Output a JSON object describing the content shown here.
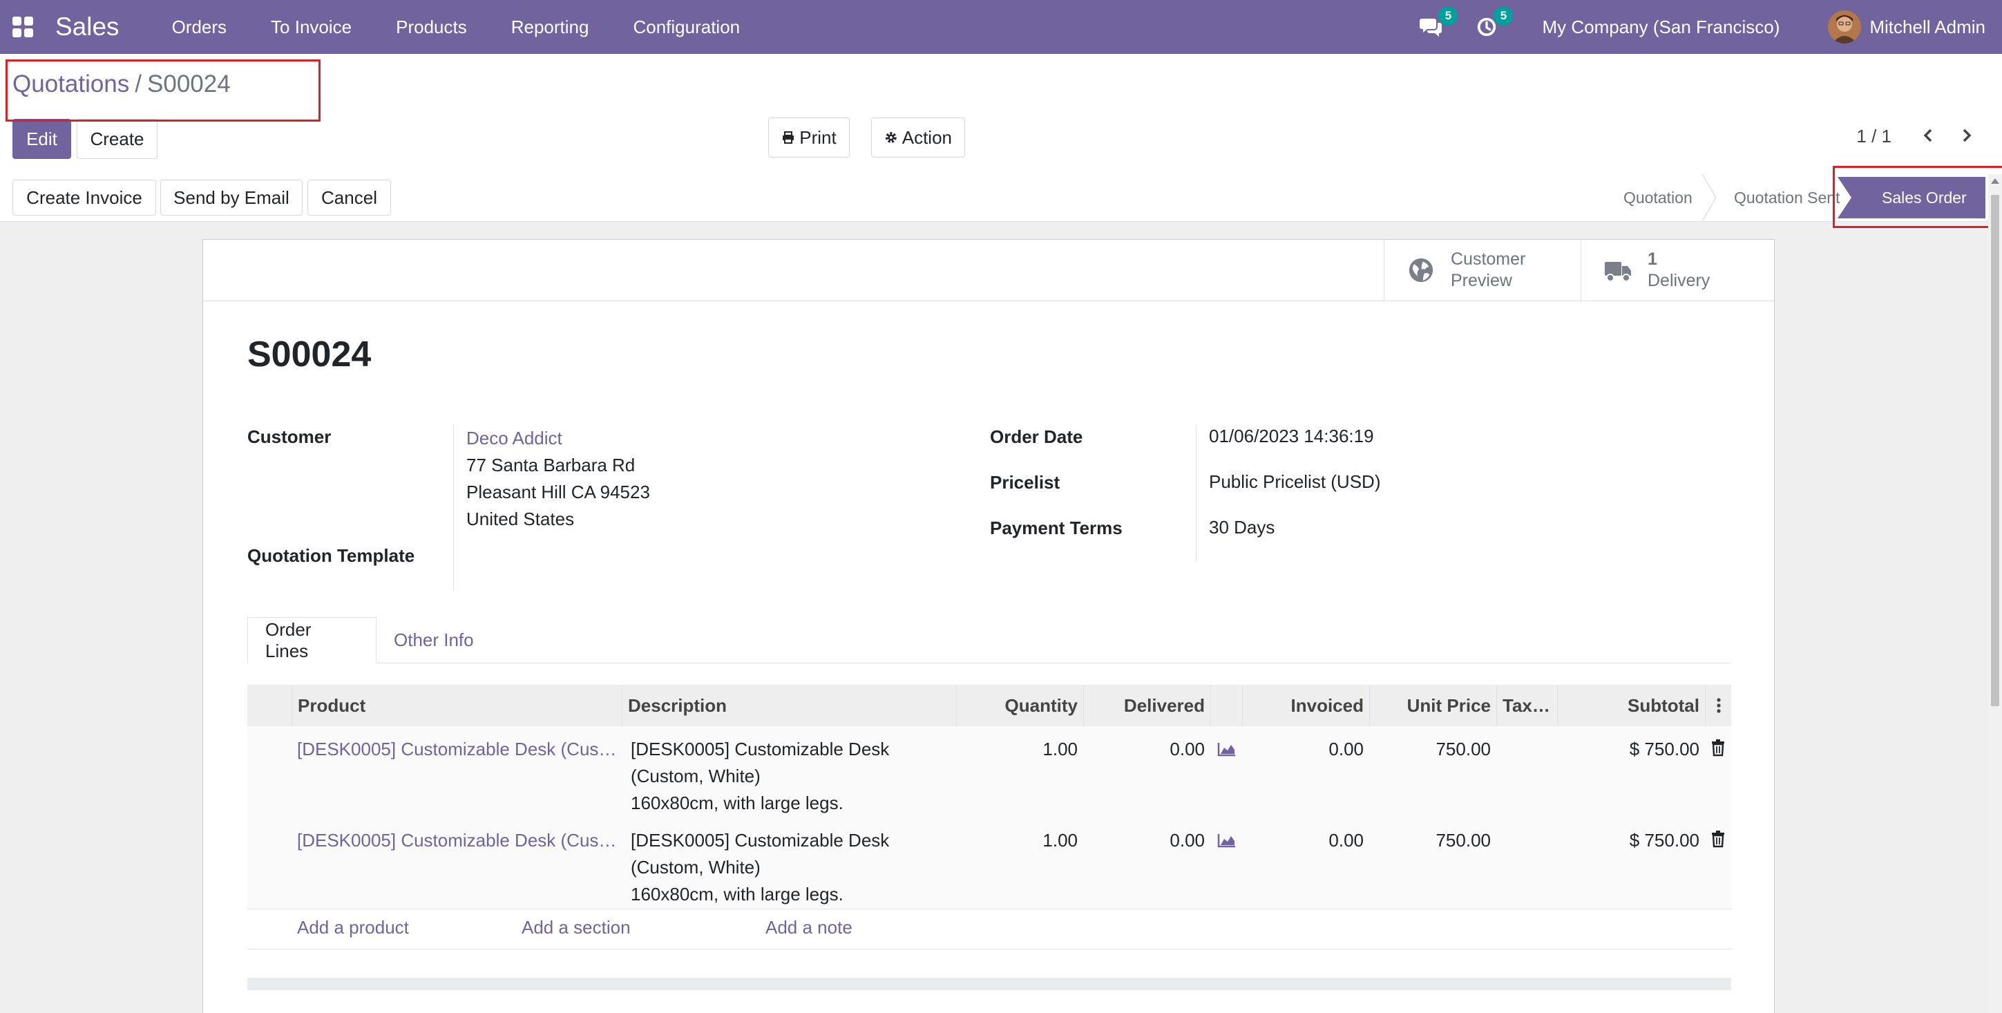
{
  "navbar": {
    "app_name": "Sales",
    "menu": [
      "Orders",
      "To Invoice",
      "Products",
      "Reporting",
      "Configuration"
    ],
    "messages_count": "5",
    "activities_count": "5",
    "company": "My Company (San Francisco)",
    "user": "Mitchell Admin",
    "icons": [
      "apps-grid-icon",
      "chat-icon",
      "clock-icon",
      "avatar"
    ]
  },
  "breadcrumb": {
    "parent": "Quotations",
    "separator": "/",
    "current": "S00024"
  },
  "buttons": {
    "edit": "Edit",
    "create": "Create",
    "print": "Print",
    "action": "Action"
  },
  "pager": {
    "value": "1 / 1"
  },
  "header_buttons": {
    "create_invoice": "Create Invoice",
    "send_email": "Send by Email",
    "cancel": "Cancel"
  },
  "statusbar": {
    "steps": [
      "Quotation",
      "Quotation Sent",
      "Sales Order"
    ],
    "active": "Sales Order"
  },
  "smart_buttons": {
    "preview": {
      "line1": "Customer",
      "line2": "Preview"
    },
    "delivery": {
      "count": "1",
      "label": "Delivery"
    }
  },
  "record": {
    "name": "S00024",
    "customer_label": "Customer",
    "customer_name": "Deco Addict",
    "address_line1": "77 Santa Barbara Rd",
    "address_line2": "Pleasant Hill CA 94523",
    "address_line3": "United States",
    "template_label": "Quotation Template",
    "order_date_label": "Order Date",
    "order_date": "01/06/2023 14:36:19",
    "pricelist_label": "Pricelist",
    "pricelist": "Public Pricelist (USD)",
    "terms_label": "Payment Terms",
    "terms": "30 Days"
  },
  "tabs": [
    "Order Lines",
    "Other Info"
  ],
  "table": {
    "headers": {
      "product": "Product",
      "description": "Description",
      "quantity": "Quantity",
      "delivered": "Delivered",
      "invoiced": "Invoiced",
      "unit_price": "Unit Price",
      "taxes": "Tax…",
      "subtotal": "Subtotal"
    },
    "rows": [
      {
        "product": "[DESK0005] Customizable Desk (Cus…",
        "desc1": "[DESK0005] Customizable Desk",
        "desc2": "(Custom, White)",
        "desc3": "160x80cm, with large legs.",
        "quantity": "1.00",
        "delivered": "0.00",
        "invoiced": "0.00",
        "unit_price": "750.00",
        "subtotal": "$ 750.00"
      },
      {
        "product": "[DESK0005] Customizable Desk (Cus…",
        "desc1": "[DESK0005] Customizable Desk",
        "desc2": "(Custom, White)",
        "desc3": "160x80cm, with large legs.",
        "quantity": "1.00",
        "delivered": "0.00",
        "invoiced": "0.00",
        "unit_price": "750.00",
        "subtotal": "$ 750.00"
      }
    ],
    "add_product": "Add a product",
    "add_section": "Add a section",
    "add_note": "Add a note"
  },
  "colors": {
    "brand": "#71639e",
    "badge": "#00a09d",
    "highlight": "#e02020"
  }
}
